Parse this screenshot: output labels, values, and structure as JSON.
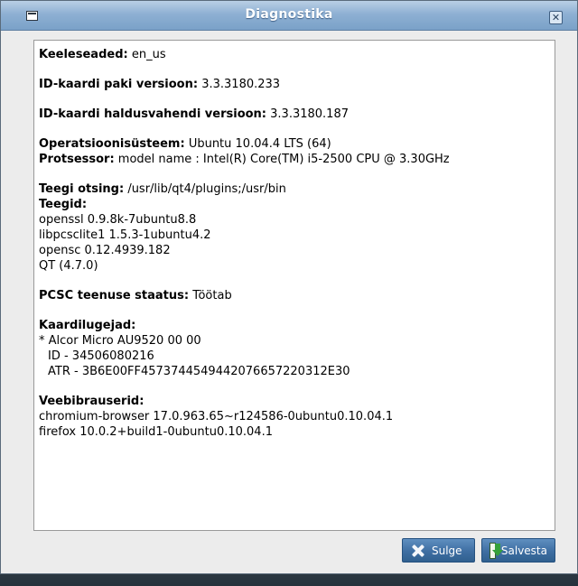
{
  "window": {
    "title": "Diagnostika"
  },
  "content": {
    "lang_label": "Keeleseaded:",
    "lang_value": "en_us",
    "pkg_label": "ID-kaardi paki versioon:",
    "pkg_value": "3.3.3180.233",
    "mgr_label": "ID-kaardi haldusvahendi versioon:",
    "mgr_value": "3.3.3180.187",
    "os_label": "Operatsioonisüsteem:",
    "os_value": "Ubuntu 10.04.4 LTS (64)",
    "cpu_label": "Protsessor:",
    "cpu_value": "model name : Intel(R) Core(TM) i5-2500 CPU @ 3.30GHz",
    "libsearch_label": "Teegi otsing:",
    "libsearch_value": "/usr/lib/qt4/plugins;/usr/bin",
    "libs_label": "Teegid:",
    "libs": [
      "openssl 0.9.8k-7ubuntu8.8",
      "libpcsclite1 1.5.3-1ubuntu4.2",
      "opensc 0.12.4939.182",
      "QT (4.7.0)"
    ],
    "pcsc_label": "PCSC teenuse staatus:",
    "pcsc_value": "Töötab",
    "readers_label": "Kaardilugejad:",
    "reader_name": "* Alcor Micro AU9520 00 00",
    "reader_id": "ID - 34506080216",
    "reader_atr": "ATR - 3B6E00FF4573744549442076657220312E30",
    "browsers_label": "Veebibrauserid:",
    "browsers": [
      "chromium-browser 17.0.963.65~r124586-0ubuntu0.10.04.1",
      "firefox 10.0.2+build1-0ubuntu0.10.04.1"
    ]
  },
  "buttons": {
    "close": "Sulge",
    "save": "Salvesta"
  },
  "icons": {
    "close": "x-icon",
    "save": "save-download-icon",
    "window_close": "close-icon",
    "app": "window-menu-icon"
  }
}
